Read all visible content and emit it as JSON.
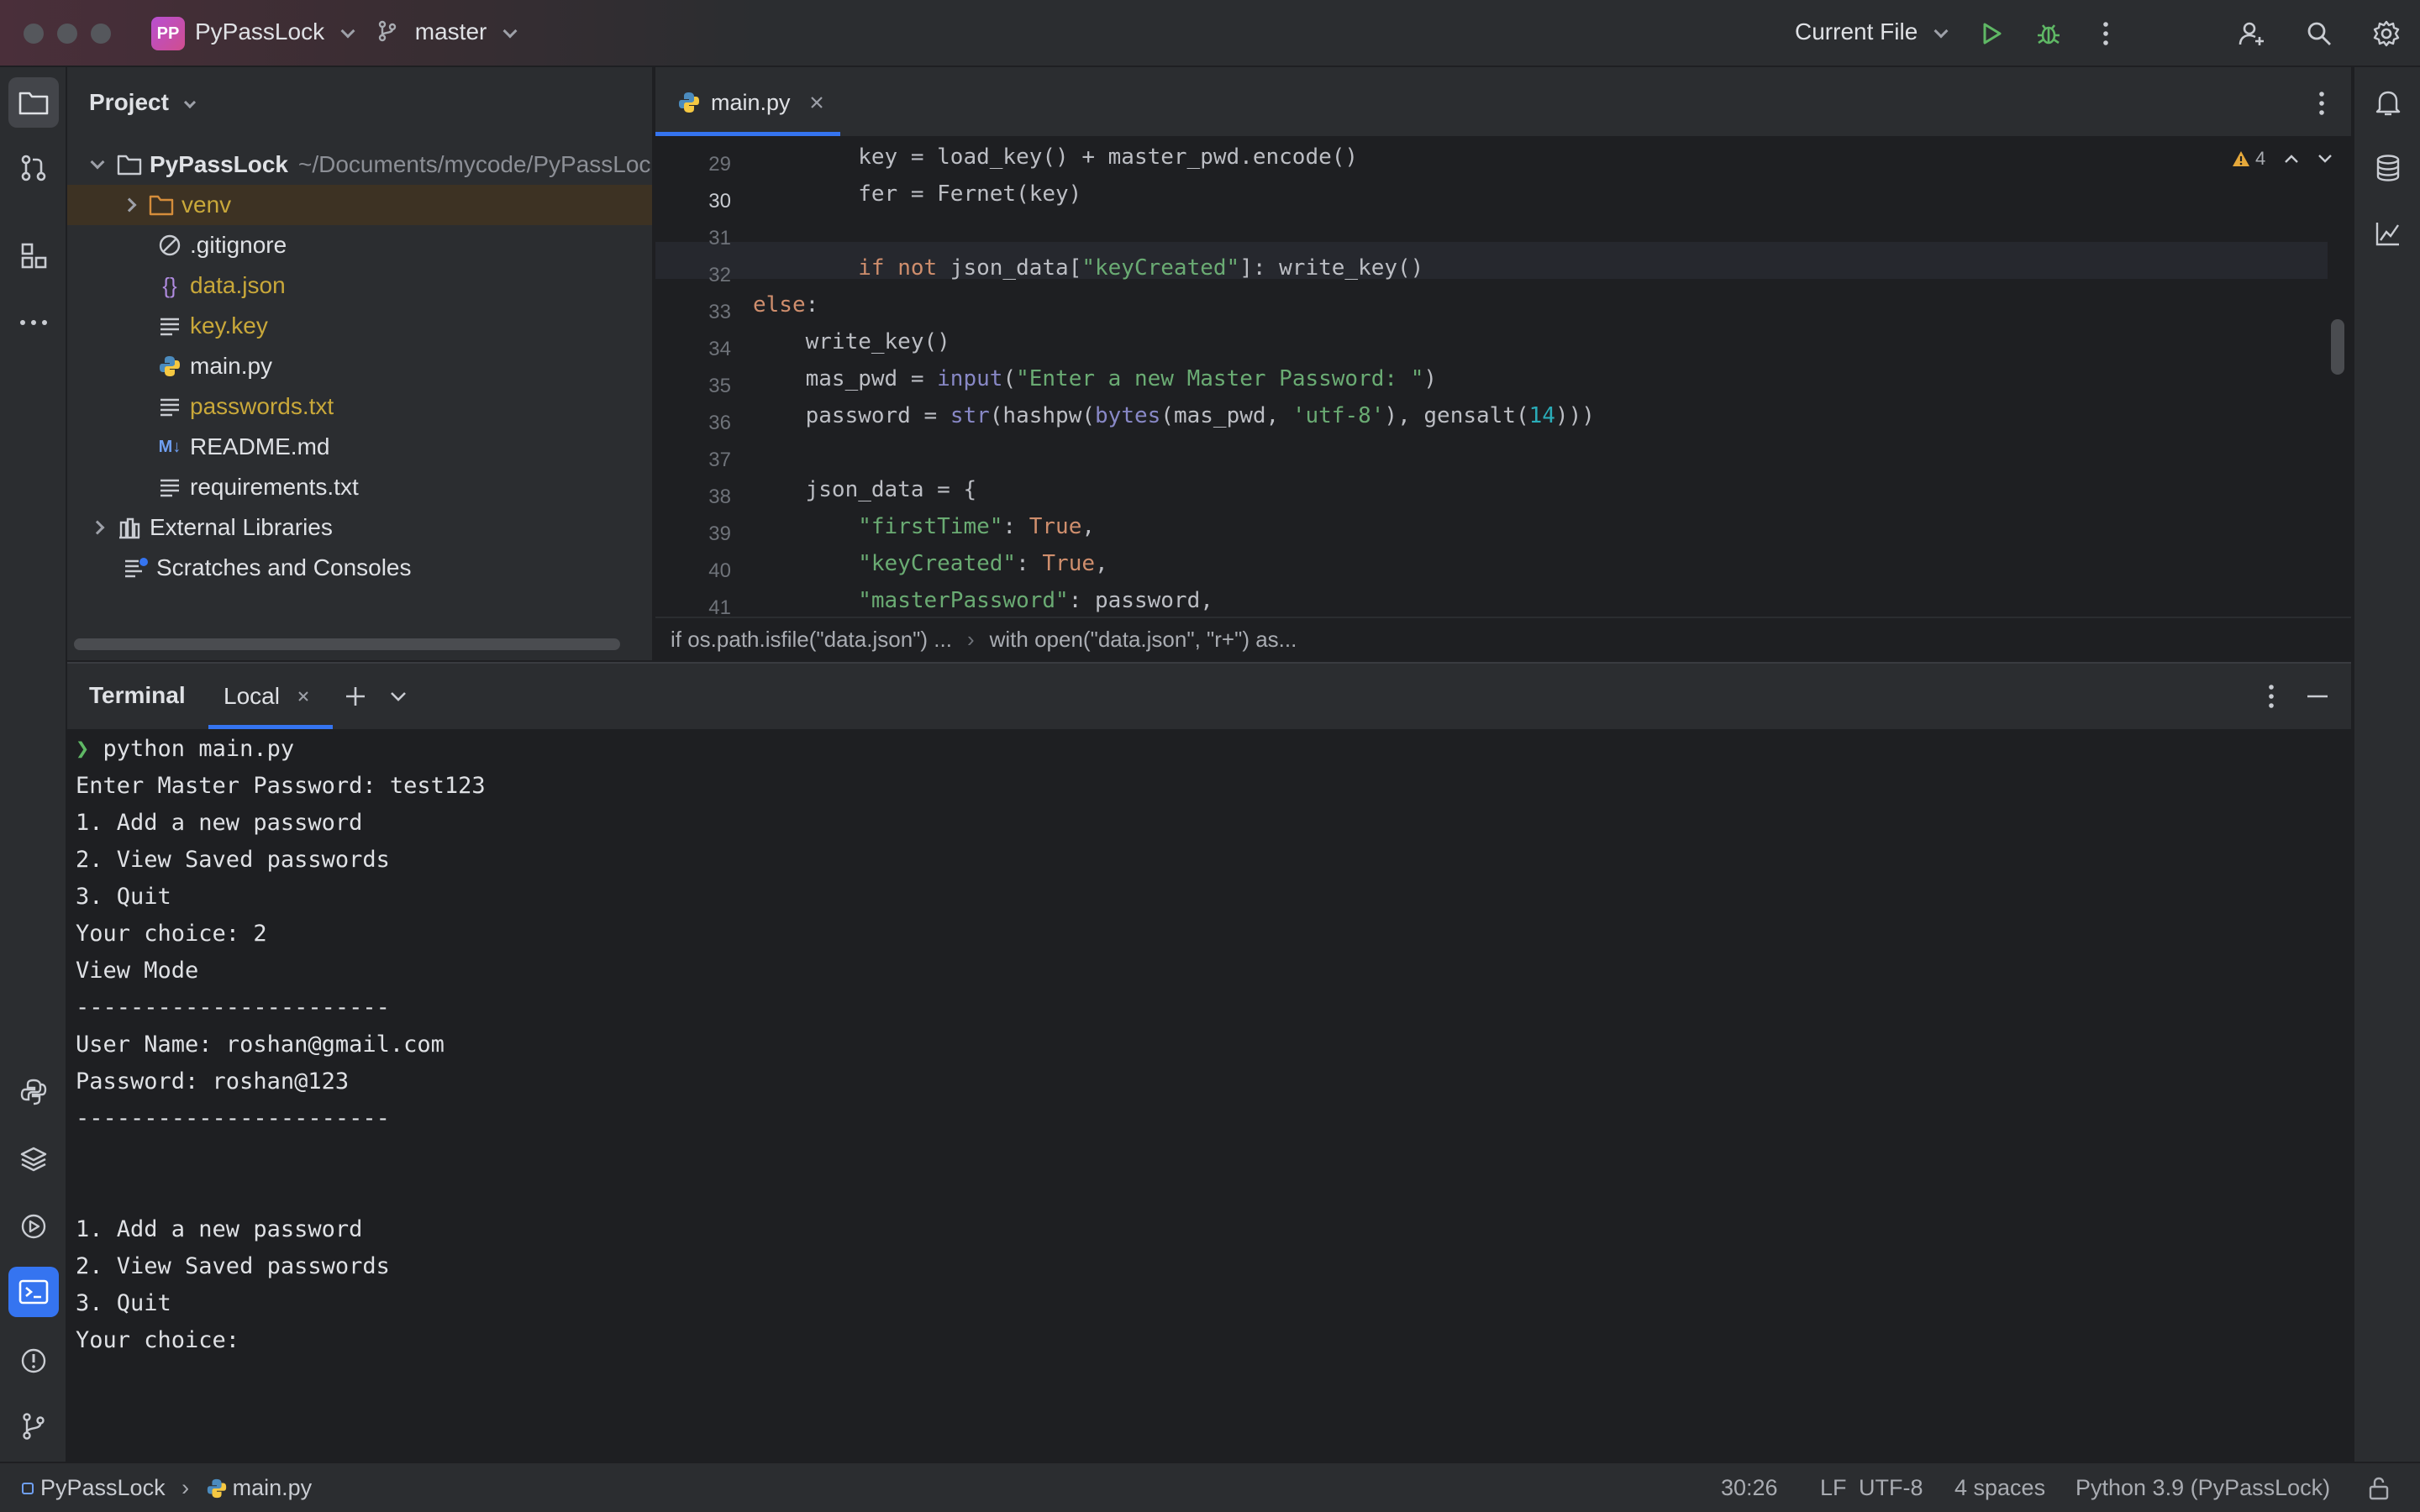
{
  "titlebar": {
    "project_badge": "PP",
    "project_name": "PyPassLock",
    "branch": "master",
    "run_config": "Current File"
  },
  "project_panel": {
    "title": "Project",
    "root_name": "PyPassLock",
    "root_path": "~/Documents/mycode/PyPassLock",
    "items": [
      {
        "label": "venv"
      },
      {
        "label": ".gitignore"
      },
      {
        "label": "data.json"
      },
      {
        "label": "key.key"
      },
      {
        "label": "main.py"
      },
      {
        "label": "passwords.txt"
      },
      {
        "label": "README.md"
      },
      {
        "label": "requirements.txt"
      }
    ],
    "external_libraries": "External Libraries",
    "scratches": "Scratches and Consoles"
  },
  "editor": {
    "tab_label": "main.py",
    "warning_count": "4",
    "line_numbers": [
      "29",
      "30",
      "31",
      "32",
      "33",
      "34",
      "35",
      "36",
      "37",
      "38",
      "39",
      "40",
      "41"
    ],
    "breadcrumb_1": "if os.path.isfile(\"data.json\") ...",
    "breadcrumb_2": "with open(\"data.json\", \"r+\") as..."
  },
  "terminal": {
    "title": "Terminal",
    "tab_label": "Local",
    "prompt_symbol": "❯",
    "command": "python main.py",
    "lines": [
      "Enter Master Password: test123",
      "1. Add a new password",
      "2. View Saved passwords",
      "3. Quit",
      "Your choice: 2",
      "View Mode",
      "-----------------------",
      "User Name: roshan@gmail.com",
      "Password: roshan@123",
      "-----------------------",
      "",
      "",
      "1. Add a new password",
      "2. View Saved passwords",
      "3. Quit",
      "Your choice:"
    ]
  },
  "statusbar": {
    "project": "PyPassLock",
    "file": "main.py",
    "position": "30:26",
    "line_sep": "LF",
    "encoding": "UTF-8",
    "indent": "4 spaces",
    "interpreter": "Python 3.9 (PyPassLock)"
  },
  "colors": {
    "accent": "#3574f0",
    "keyword": "#cf8e6d",
    "string": "#6aab73",
    "builtin": "#8888c6",
    "number": "#2aacb8",
    "run_green": "#5fb865"
  }
}
